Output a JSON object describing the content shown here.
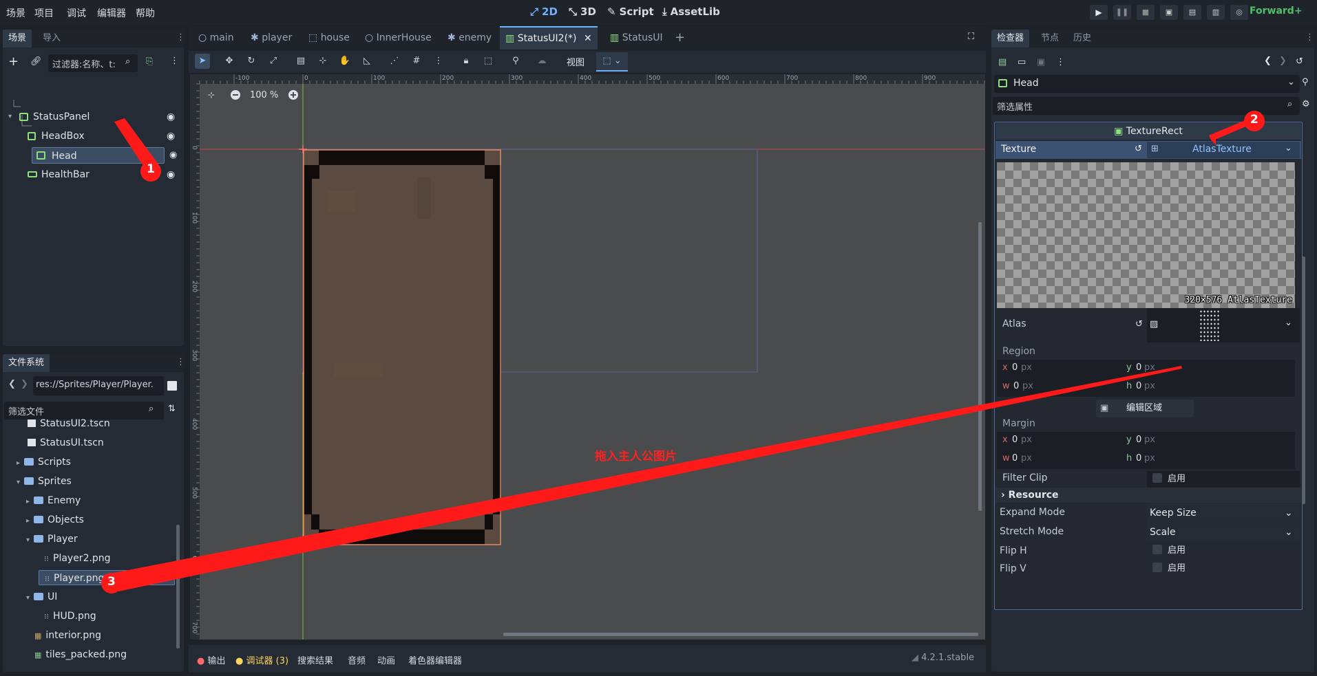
{
  "menu": [
    "场景",
    "项目",
    "调试",
    "编辑器",
    "帮助"
  ],
  "modes": {
    "m2d": "2D",
    "m3d": "3D",
    "script": "Script",
    "assetlib": "AssetLib"
  },
  "renderer": "Forward+",
  "scene_dock": {
    "tabs": [
      "场景",
      "导入"
    ],
    "filter_placeholder": "过滤器:名称、t:",
    "nodes": [
      {
        "label": "StatusPanel",
        "icon": "control-icon"
      },
      {
        "label": "HeadBox",
        "icon": "container-icon"
      },
      {
        "label": "Head",
        "icon": "texturerect-icon"
      },
      {
        "label": "HealthBar",
        "icon": "progressbar-icon"
      }
    ]
  },
  "filesystem": {
    "tab": "文件系统",
    "path": "res://Sprites/Player/Player.",
    "filter_placeholder": "筛选文件",
    "items": [
      {
        "label": "StatusUI2.tscn",
        "type": "scene"
      },
      {
        "label": "StatusUI.tscn",
        "type": "scene"
      },
      {
        "label": "Scripts",
        "type": "folder"
      },
      {
        "label": "Sprites",
        "type": "folder"
      },
      {
        "label": "Enemy",
        "type": "folder"
      },
      {
        "label": "Objects",
        "type": "folder"
      },
      {
        "label": "Player",
        "type": "folder"
      },
      {
        "label": "Player2.png",
        "type": "image"
      },
      {
        "label": "Player.png",
        "type": "image"
      },
      {
        "label": "UI",
        "type": "folder"
      },
      {
        "label": "HUD.png",
        "type": "image"
      },
      {
        "label": "interior.png",
        "type": "image"
      },
      {
        "label": "tiles_packed.png",
        "type": "image"
      }
    ]
  },
  "editor_tabs": [
    "main",
    "player",
    "house",
    "InnerHouse",
    "enemy",
    "StatusUI2(*)",
    "StatusUI"
  ],
  "toolbar": {
    "view_label": "视图"
  },
  "canvas": {
    "zoom": "100 %",
    "ruler_h": [
      "-100",
      "0",
      "100",
      "200",
      "300",
      "400",
      "500",
      "600",
      "700",
      "800",
      "900"
    ],
    "ruler_v": [
      "0",
      "100",
      "200",
      "300",
      "400",
      "500",
      "600",
      "700"
    ],
    "annotation": "拖入主人公图片"
  },
  "bottom_tabs": [
    "输出",
    "调试器 (3)",
    "搜索结果",
    "音频",
    "动画",
    "着色器编辑器"
  ],
  "version": "4.2.1.stable",
  "inspector": {
    "tabs": [
      "检查器",
      "节点",
      "历史"
    ],
    "node_name": "Head",
    "filter_placeholder": "筛选属性",
    "class_name": "TextureRect",
    "texture_label": "Texture",
    "texture_value": "AtlasTexture",
    "preview_caption": "320×576 AtlasTexture",
    "atlas_label": "Atlas",
    "region_label": "Region",
    "region": {
      "x": "0",
      "y": "0",
      "w": "0",
      "h": "0"
    },
    "unit": "px",
    "edit_region": "编辑区域",
    "margin_label": "Margin",
    "margin": {
      "x": "0",
      "y": "0",
      "w": "0",
      "h": "0"
    },
    "filter_clip_label": "Filter Clip",
    "enable": "启用",
    "resource_label": "Resource",
    "expand_mode_label": "Expand Mode",
    "expand_mode_value": "Keep Size",
    "stretch_mode_label": "Stretch Mode",
    "stretch_mode_value": "Scale",
    "flip_h_label": "Flip H",
    "flip_v_label": "Flip V"
  },
  "markers": [
    "1",
    "2",
    "3"
  ],
  "colors": {
    "accent": "#6fb0ff",
    "annotation": "#ff1a1a",
    "panel": "#252b34"
  }
}
